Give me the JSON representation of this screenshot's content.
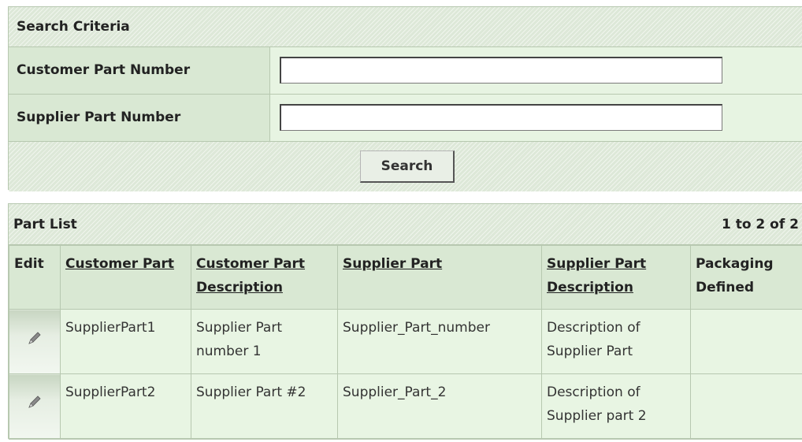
{
  "search": {
    "title": "Search Criteria",
    "customer_part_label": "Customer Part Number",
    "customer_part_value": "",
    "supplier_part_label": "Supplier Part Number",
    "supplier_part_value": "",
    "search_button": "Search"
  },
  "part_list": {
    "title": "Part List",
    "count": "1 to 2 of 2",
    "columns": {
      "edit": "Edit",
      "customer_part": "Customer Part",
      "customer_part_description": "Customer Part Description",
      "supplier_part": "Supplier Part",
      "supplier_part_description": "Supplier Part Description",
      "packaging_defined": "Packaging Defined"
    },
    "rows": [
      {
        "edit_icon": "pencil-icon",
        "customer_part": "SupplierPart1",
        "customer_part_description": "Supplier Part number 1",
        "supplier_part": "Supplier_Part_number",
        "supplier_part_description": "Description of Supplier Part",
        "packaging_defined": ""
      },
      {
        "edit_icon": "pencil-icon",
        "customer_part": "SupplierPart2",
        "customer_part_description": "Supplier Part #2",
        "supplier_part": "Supplier_Part_2",
        "supplier_part_description": "Description of Supplier part 2",
        "packaging_defined": ""
      }
    ]
  }
}
